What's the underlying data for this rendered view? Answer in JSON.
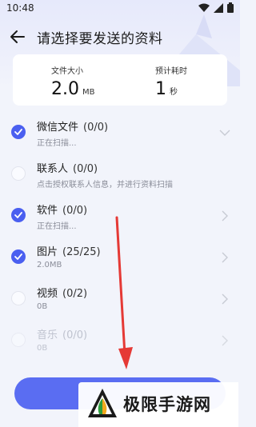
{
  "status_bar": {
    "time": "10:48"
  },
  "header": {
    "title": "请选择要发送的资料"
  },
  "summary": {
    "size_label": "文件大小",
    "size_value": "2.0",
    "size_unit": "MB",
    "time_label": "预计耗时",
    "time_value": "1",
    "time_unit": "秒"
  },
  "items": [
    {
      "title": "微信文件",
      "count": "(0/0)",
      "subtitle": "正在扫描...",
      "checked": true,
      "chevron": "chevron-down"
    },
    {
      "title": "联系人",
      "count": "(0/0)",
      "subtitle": "点击授权联系人信息，并进行资料扫描",
      "checked": false,
      "chevron": "none"
    },
    {
      "title": "软件",
      "count": "(0/0)",
      "subtitle": "正在扫描...",
      "checked": true,
      "chevron": "chevron-right"
    },
    {
      "title": "图片",
      "count": "(25/25)",
      "subtitle": "2.0MB",
      "checked": true,
      "chevron": "chevron-right"
    },
    {
      "title": "视频",
      "count": "(0/2)",
      "subtitle": "0B",
      "checked": false,
      "chevron": "chevron-right"
    },
    {
      "title": "音乐",
      "count": "(0/0)",
      "subtitle": "0B",
      "checked": false,
      "chevron": "chevron-right"
    }
  ],
  "colors": {
    "accent": "#4a5ff0",
    "button": "#5a6df2",
    "arrow": "#e53935"
  },
  "watermark": {
    "text": "极限手游网"
  }
}
